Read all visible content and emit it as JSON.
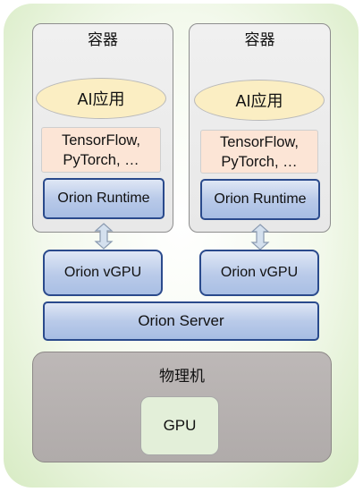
{
  "containers": [
    {
      "title": "容器",
      "app": "AI应用",
      "frameworks_line1": "TensorFlow,",
      "frameworks_line2": "PyTorch, …",
      "runtime": "Orion Runtime"
    },
    {
      "title": "容器",
      "app": "AI应用",
      "frameworks_line1": "TensorFlow,",
      "frameworks_line2": "PyTorch, …",
      "runtime": "Orion Runtime"
    }
  ],
  "vgpus": [
    {
      "label": "Orion vGPU"
    },
    {
      "label": "Orion vGPU"
    }
  ],
  "server": {
    "label": "Orion Server"
  },
  "physical_machine": {
    "title": "物理机",
    "gpu": "GPU"
  },
  "colors": {
    "runtime_border": "#2a4a8c",
    "app_fill": "#fbeec3",
    "framework_fill": "#fce5d6",
    "physical_fill": "#b0abaa",
    "gpu_fill": "#e3efd9",
    "background_edge": "#d7ebc3"
  }
}
